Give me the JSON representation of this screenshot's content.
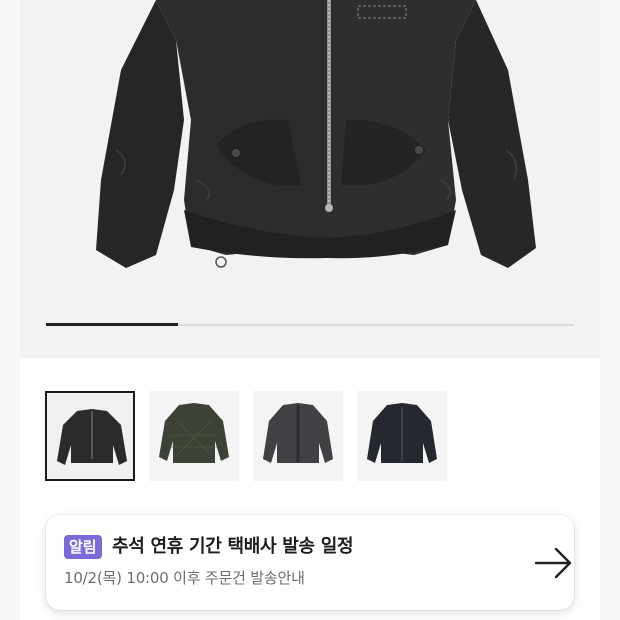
{
  "gallery": {
    "main_image": "black-liner-jacket-photo",
    "progress": 0.25,
    "thumbnails": [
      {
        "image": "black-jacket-front",
        "color": "#2a2b2d",
        "selected": true
      },
      {
        "image": "olive-quilted-jacket-front",
        "color": "#3d4236",
        "selected": false
      },
      {
        "image": "charcoal-reversible-jacket-front",
        "color": "#3f4144",
        "selected": false
      },
      {
        "image": "navy-jacket-front",
        "color": "#25282f",
        "selected": false
      }
    ]
  },
  "notice": {
    "badge": "알림",
    "title": "추석 연휴 기간 택배사 발송 일정",
    "subtitle": "10/2(목) 10:00 이후 주문건 발송안내",
    "arrow_icon": "arrow-right-icon",
    "badge_color": "#7b6bd9"
  }
}
